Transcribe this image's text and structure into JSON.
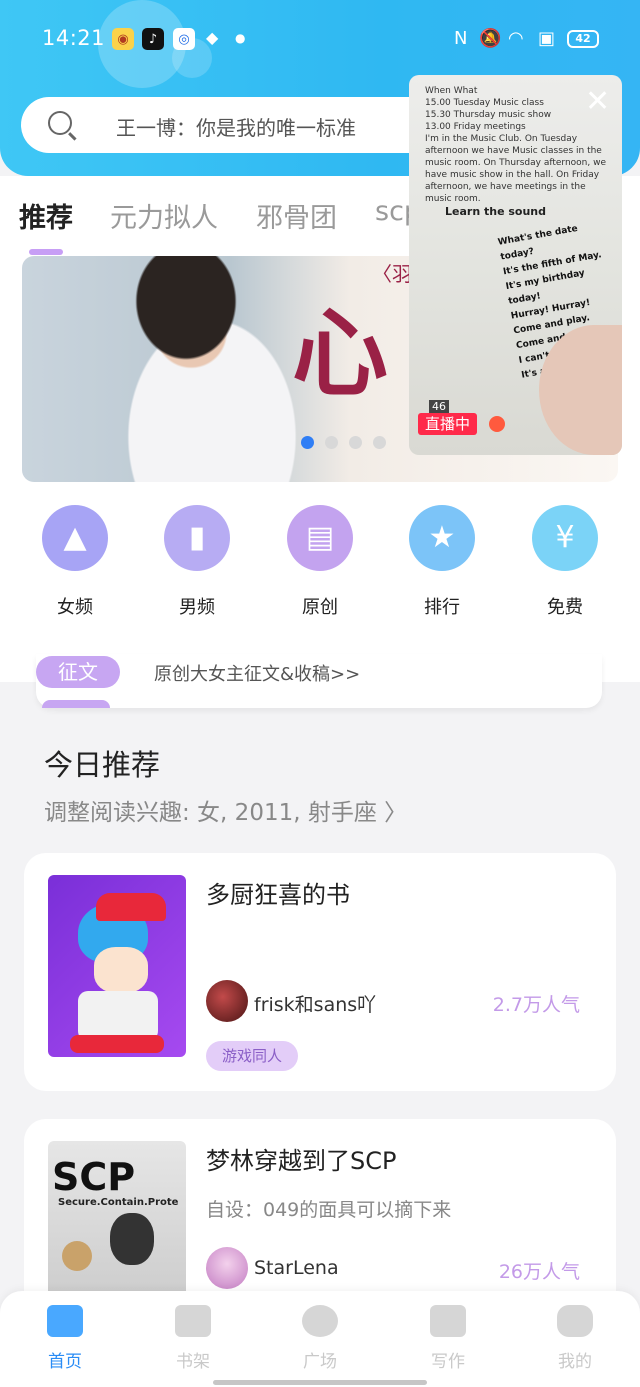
{
  "status_bar": {
    "time": "14:21",
    "battery": "42",
    "app_icons": [
      "weibo-icon",
      "tiktok-icon",
      "app-circle-icon",
      "layers-icon"
    ],
    "indicators": [
      "nfc-icon",
      "mute-icon",
      "wifi-icon",
      "sim-icon"
    ]
  },
  "search": {
    "placeholder": "王一博：你是我的唯一标准"
  },
  "tabs": [
    {
      "label": "推荐",
      "active": true
    },
    {
      "label": "元力拟人"
    },
    {
      "label": "邪骨团"
    },
    {
      "label": "scp"
    }
  ],
  "banner": {
    "art_text": "心",
    "small_text": "〈羽",
    "page_count": 4,
    "active_page": 1
  },
  "live_pip": {
    "badge": "直播中",
    "close": "✕",
    "page_text": "When What\n15.00 Tuesday Music class\n15.30 Thursday music show\n13.00 Friday meetings\nI'm in the Music Club. On Tuesday afternoon we have Music classes in the music room. On Thursday afternoon, we have music show in the hall. On Friday afternoon, we have meetings in the music room.",
    "heading": "Learn the sound",
    "poem": "What's the date today?\nIt's the fifth of May.\nIt's my birthday today!\nHurray! Hurray!\nCome and play.\nCome and play.\nI can't wait!\nIt's a happy day!",
    "page_number": "46"
  },
  "categories": [
    {
      "label": "女频",
      "color": "#a7a4f5",
      "icon": "dress-icon"
    },
    {
      "label": "男频",
      "color": "#b7acf3",
      "icon": "shirt-icon"
    },
    {
      "label": "原创",
      "color": "#c3a3ef",
      "icon": "book-icon"
    },
    {
      "label": "排行",
      "color": "#7cc4f8",
      "icon": "trophy-icon"
    },
    {
      "label": "免费",
      "color": "#7bd3f7",
      "icon": "coin-icon"
    }
  ],
  "notice": {
    "tag": "征文",
    "text": "原创大女主征文&收稿>>"
  },
  "section": {
    "title": "今日推荐",
    "subtitle": "调整阅读兴趣: 女, 2011, 射手座 〉"
  },
  "books": [
    {
      "title": "多厨狂喜的书",
      "author": "frisk和sans吖",
      "popularity": "2.7万人气",
      "genre": "游戏同人"
    },
    {
      "title": "梦林穿越到了SCP",
      "description": "自设：049的面具可以摘下来",
      "author": "StarLena",
      "popularity": "26万人气",
      "cover_text": "SCP",
      "cover_subtext": "Secure.Contain.Prote"
    }
  ],
  "bottom_nav": [
    {
      "label": "首页",
      "icon": "home-icon",
      "active": true
    },
    {
      "label": "书架",
      "icon": "bookshelf-icon"
    },
    {
      "label": "广场",
      "icon": "planet-icon"
    },
    {
      "label": "写作",
      "icon": "pen-icon"
    },
    {
      "label": "我的",
      "icon": "chat-icon"
    }
  ],
  "colors": {
    "header": "#2fb8f2",
    "accent_purple": "#c79ef5",
    "active_nav": "#2a8cf5",
    "live_red": "#ff2a4a"
  }
}
